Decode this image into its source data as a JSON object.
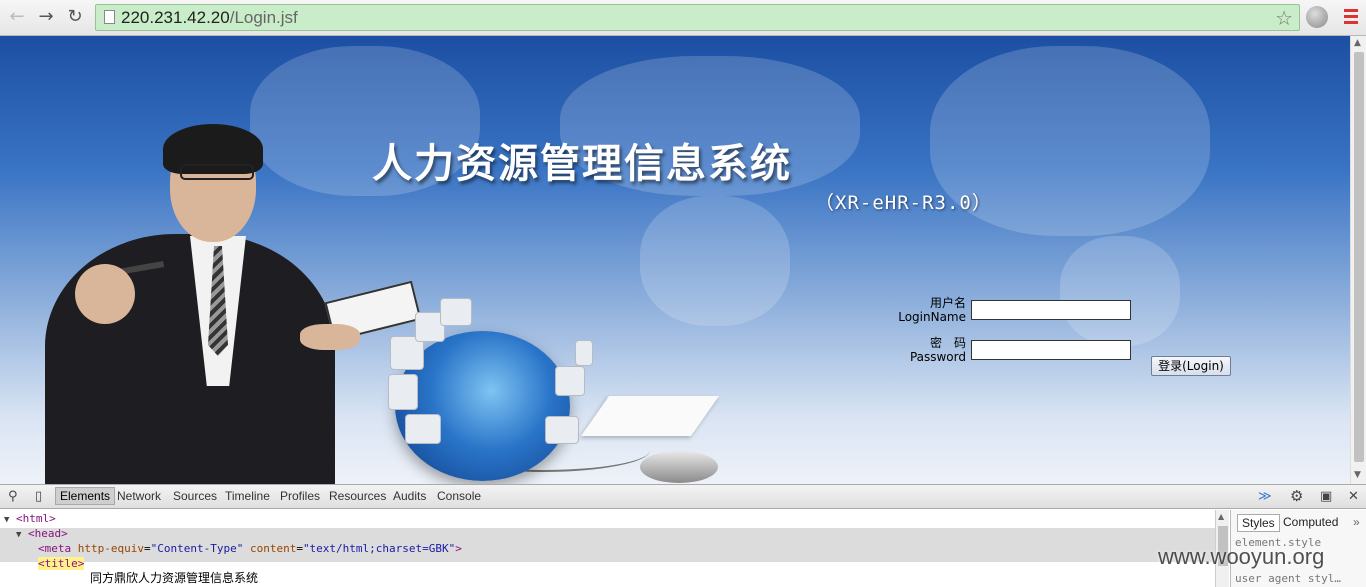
{
  "browser": {
    "url_host": "220.231.42.20",
    "url_path": "/Login.jsf",
    "back_icon": "back-arrow-icon",
    "forward_icon": "forward-arrow-icon",
    "reload_icon": "reload-icon"
  },
  "page": {
    "system_title": "人力资源管理信息系统",
    "version": "（XR-eHR-R3.0）",
    "username_label_cn": "用户名",
    "username_label_en": "LoginName",
    "password_label_cn": "密　码",
    "password_label_en": "Password",
    "username_value": "",
    "password_value": "",
    "login_button": "登录(Login)"
  },
  "devtools": {
    "tabs": [
      "Elements",
      "Network",
      "Sources",
      "Timeline",
      "Profiles",
      "Resources",
      "Audits",
      "Console"
    ],
    "active_tab": "Elements",
    "code": {
      "html_open": "<html>",
      "head_open": "<head>",
      "meta_tag": "meta",
      "meta_attr1": "http-equiv",
      "meta_val1": "\"Content-Type\"",
      "meta_attr2": "content",
      "meta_val2": "\"text/html;charset=GBK\"",
      "title_tag": "title",
      "title_text": "同方鼎欣人力资源管理信息系统"
    },
    "styles_tabs": [
      "Styles",
      "Computed"
    ],
    "styles_line1": "element.style",
    "styles_line2": "user agent styl…"
  },
  "watermark": "www.wooyun.org"
}
